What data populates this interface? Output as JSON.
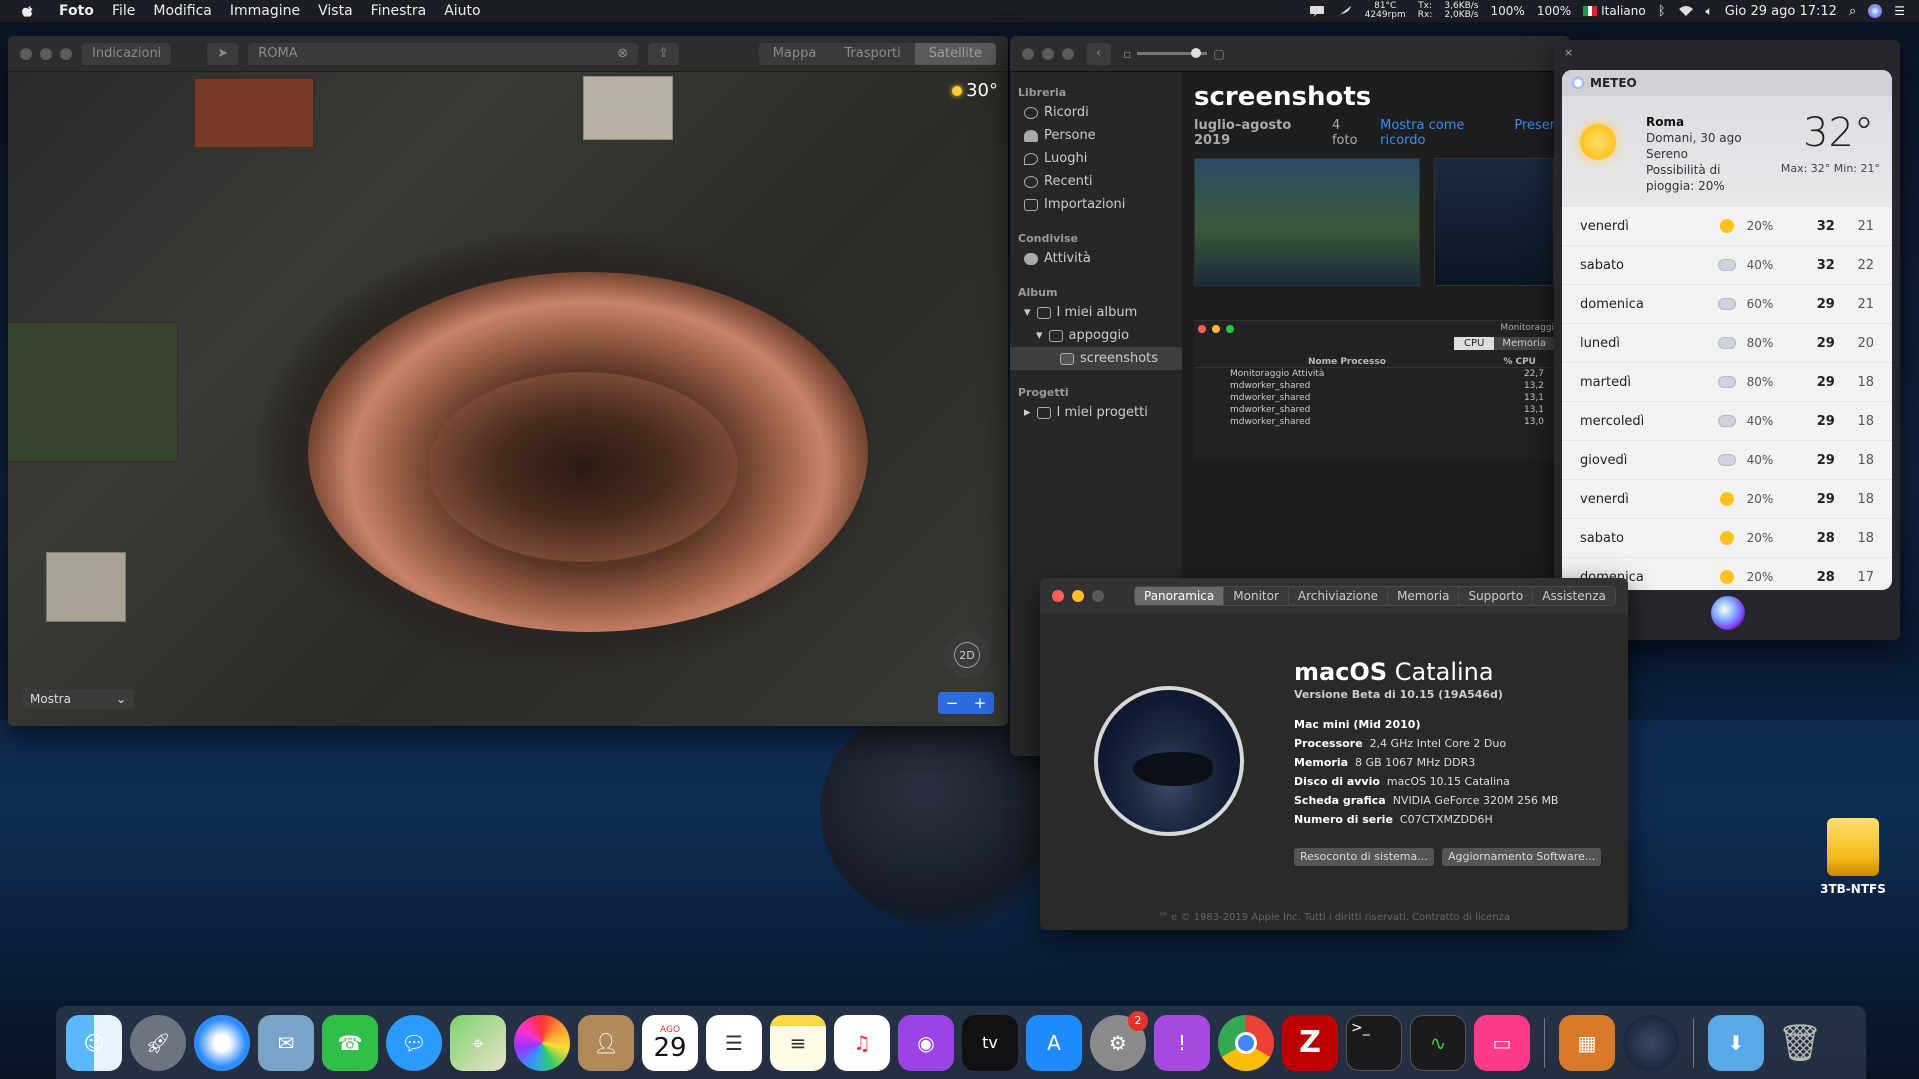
{
  "menubar": {
    "app": "Foto",
    "items": [
      "File",
      "Modifica",
      "Immagine",
      "Vista",
      "Finestra",
      "Aiuto"
    ],
    "temp": "81°C",
    "rpm": "4249rpm",
    "net_tx": "Tx:",
    "net_rx": "Rx:",
    "net_rate1": "3,6KB/s",
    "net_rate2": "2,0KB/s",
    "battery1": "100%",
    "battery2": "100%",
    "language": "Italiano",
    "datetime": "Gio 29 ago  17:12"
  },
  "maps": {
    "directions": "Indicazioni",
    "search": "ROMA",
    "tabs": [
      "Mappa",
      "Trasporti",
      "Satellite"
    ],
    "temperature": "30°",
    "view_toggle": "2D",
    "show_label": "Mostra",
    "zoom_out": "−",
    "zoom_in": "+"
  },
  "photos": {
    "sidebar": {
      "library_header": "Libreria",
      "library": [
        "Ricordi",
        "Persone",
        "Luoghi",
        "Recenti",
        "Importazioni"
      ],
      "shared_header": "Condivise",
      "shared": [
        "Attività"
      ],
      "album_header": "Album",
      "albums": [
        "I miei album",
        "appoggio",
        "screenshots"
      ],
      "projects_header": "Progetti",
      "projects": [
        "I miei progetti"
      ]
    },
    "title": "screenshots",
    "range": "luglio–agosto 2019",
    "count": "4 foto",
    "memory_link": "Mostra come ricordo",
    "present_link": "Presen",
    "actmon": {
      "title": "Monitoraggi",
      "tabs": [
        "CPU",
        "Memoria"
      ],
      "col_process": "Nome Processo",
      "col_cpu": "% CPU",
      "rows": [
        {
          "name": "Monitoraggio Attività",
          "cpu": "22,7"
        },
        {
          "name": "mdworker_shared",
          "cpu": "13,2"
        },
        {
          "name": "mdworker_shared",
          "cpu": "13,1"
        },
        {
          "name": "mdworker_shared",
          "cpu": "13,1"
        },
        {
          "name": "mdworker_shared",
          "cpu": "13,0"
        }
      ]
    }
  },
  "weather": {
    "app": "METEO",
    "city": "Roma",
    "line1": "Domani, 30 ago",
    "line2": "Sereno",
    "line3": "Possibilità di",
    "line4": "pioggia: 20%",
    "temp": "32°",
    "maxmin": "Max: 32° Min: 21°",
    "days": [
      {
        "day": "venerdì",
        "icon": "sun",
        "pct": "20%",
        "max": "32",
        "min": "21"
      },
      {
        "day": "sabato",
        "icon": "cloud",
        "pct": "40%",
        "max": "32",
        "min": "22"
      },
      {
        "day": "domenica",
        "icon": "cloud",
        "pct": "60%",
        "max": "29",
        "min": "21"
      },
      {
        "day": "lunedì",
        "icon": "cloud",
        "pct": "80%",
        "max": "29",
        "min": "20"
      },
      {
        "day": "martedì",
        "icon": "cloud",
        "pct": "80%",
        "max": "29",
        "min": "18"
      },
      {
        "day": "mercoledì",
        "icon": "cloud",
        "pct": "40%",
        "max": "29",
        "min": "18"
      },
      {
        "day": "giovedì",
        "icon": "cloud",
        "pct": "40%",
        "max": "29",
        "min": "18"
      },
      {
        "day": "venerdì",
        "icon": "sun",
        "pct": "20%",
        "max": "29",
        "min": "18"
      },
      {
        "day": "sabato",
        "icon": "sun",
        "pct": "20%",
        "max": "28",
        "min": "18"
      },
      {
        "day": "domenica",
        "icon": "sun",
        "pct": "20%",
        "max": "28",
        "min": "17"
      }
    ],
    "help": "?"
  },
  "about": {
    "tabs": [
      "Panoramica",
      "Monitor",
      "Archiviazione",
      "Memoria",
      "Supporto",
      "Assistenza"
    ],
    "title_a": "macOS",
    "title_b": " Catalina",
    "version": "Versione Beta di 10.15 (19A546d)",
    "specs": [
      {
        "k": "Mac mini (Mid 2010)",
        "v": ""
      },
      {
        "k": "Processore",
        "v": "2,4 GHz Intel Core 2 Duo"
      },
      {
        "k": "Memoria",
        "v": "8 GB 1067 MHz DDR3"
      },
      {
        "k": "Disco di avvio",
        "v": "macOS 10.15 Catalina"
      },
      {
        "k": "Scheda grafica",
        "v": "NVIDIA GeForce 320M 256 MB"
      },
      {
        "k": "Numero di serie",
        "v": "C07CTXMZDD6H"
      }
    ],
    "btn_report": "Resoconto di sistema...",
    "btn_update": "Aggiornamento Software...",
    "footer": "™ e © 1983-2019 Apple Inc. Tutti i diritti riservati. Contratto di licenza"
  },
  "desktop": {
    "drive": "3TB-NTFS"
  },
  "dock": {
    "calendar_month": "AGO",
    "calendar_day": "29",
    "sysprefs_badge": "2",
    "tv_label": "tv",
    "filezilla_label": "Z",
    "terminal_label": ">_"
  }
}
